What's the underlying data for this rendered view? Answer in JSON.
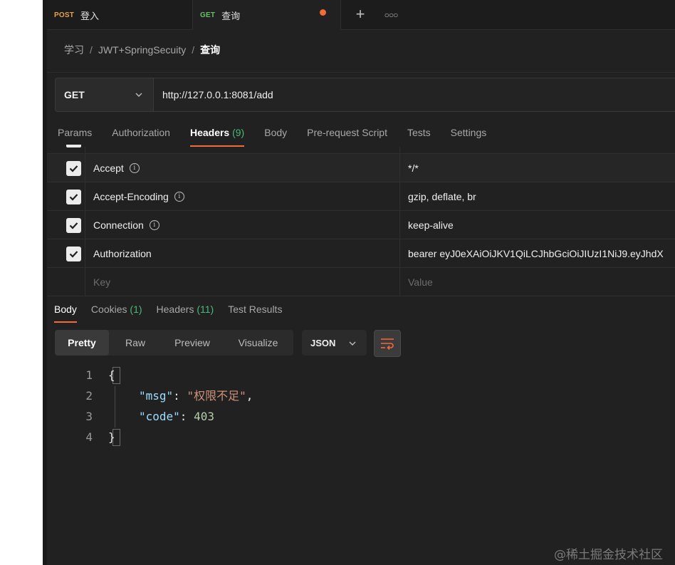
{
  "tabs": [
    {
      "method": "POST",
      "name": "登入"
    },
    {
      "method": "GET",
      "name": "查询",
      "unsaved": true
    }
  ],
  "breadcrumb": [
    "学习",
    "JWT+SpringSecuity",
    "查询"
  ],
  "request": {
    "method": "GET",
    "url": "http://127.0.0.1:8081/add"
  },
  "request_tabs": {
    "params": "Params",
    "authorization": "Authorization",
    "headers": "Headers",
    "headers_count": "(9)",
    "body": "Body",
    "pre_request": "Pre-request Script",
    "tests": "Tests",
    "settings": "Settings"
  },
  "headers": [
    {
      "key": "Accept",
      "value": "*/*",
      "checked": true
    },
    {
      "key": "Accept-Encoding",
      "value": "gzip, deflate, br",
      "checked": true
    },
    {
      "key": "Connection",
      "value": "keep-alive",
      "checked": true
    },
    {
      "key": "Authorization",
      "value": "bearer eyJ0eXAiOiJKV1QiLCJhbGciOiJIUzI1NiJ9.eyJhdX",
      "checked": true
    }
  ],
  "new_header": {
    "key_placeholder": "Key",
    "value_placeholder": "Value"
  },
  "response_tabs": {
    "body": "Body",
    "cookies": "Cookies",
    "cookies_count": "(1)",
    "headers": "Headers",
    "headers_count": "(11)",
    "test_results": "Test Results"
  },
  "response_view": {
    "pretty": "Pretty",
    "raw": "Raw",
    "preview": "Preview",
    "visualize": "Visualize",
    "format": "JSON"
  },
  "response_code": {
    "line_numbers": [
      "1",
      "2",
      "3",
      "4"
    ],
    "open_brace": "{",
    "close_brace": "}",
    "msg_key": "\"msg\"",
    "msg_value": "\"权限不足\"",
    "code_key": "\"code\"",
    "code_value": "403"
  },
  "watermark": "@稀土掘金技术社区",
  "colors": {
    "accent": "#f26b3a",
    "count_green": "#4bb87a",
    "get_method": "#6bbf6b",
    "post_method": "#e5a24a"
  }
}
